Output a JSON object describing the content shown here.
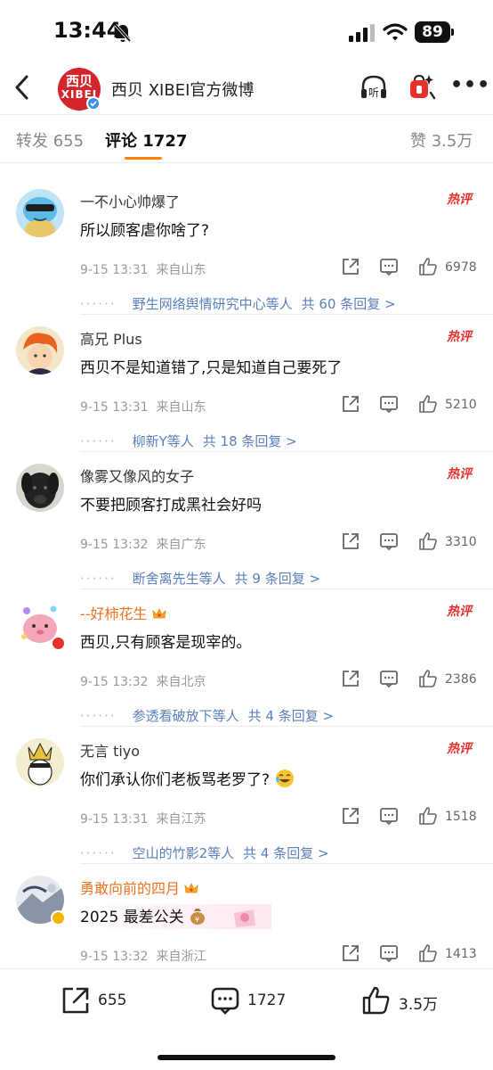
{
  "status_bar": {
    "time": "13:44",
    "battery": "89"
  },
  "header": {
    "avatar_line1": "西贝",
    "avatar_line2": "XIBEI",
    "title": "西贝 XIBEI官方微博",
    "listen_label": "听"
  },
  "tabs": {
    "reposts": "转发 655",
    "comments": "评论 1727",
    "likes": "赞 3.5万"
  },
  "hot_label": "热评",
  "comments": [
    {
      "name": "一不小心帅爆了",
      "text": "所以顾客虐你啥了?",
      "time": "9-15 13:31",
      "location": "来自山东",
      "likes": "6978",
      "reply_users": "野生网络舆情研究中心等人",
      "reply_count": "共 60 条回复 >"
    },
    {
      "name": "高兄 Plus",
      "text": "西贝不是知道错了,只是知道自己要死了",
      "time": "9-15 13:31",
      "location": "来自山东",
      "likes": "5210",
      "reply_users": "柳新Y等人",
      "reply_count": "共 18 条回复 >"
    },
    {
      "name": "像雾又像风的女子",
      "text": "不要把顾客打成黑社会好吗",
      "time": "9-15 13:32",
      "location": "来自广东",
      "likes": "3310",
      "reply_users": "断舍离先生等人",
      "reply_count": "共 9 条回复 >"
    },
    {
      "name": "--好柿花生",
      "text": "西贝,只有顾客是现宰的。",
      "time": "9-15 13:32",
      "location": "来自北京",
      "likes": "2386",
      "reply_users": "参透看破放下等人",
      "reply_count": "共 4 条回复 >"
    },
    {
      "name": "无言 tiyo",
      "text": "你们承认你们老板骂老罗了?",
      "time": "9-15 13:31",
      "location": "来自江苏",
      "likes": "1518",
      "reply_users": "空山的竹影2等人",
      "reply_count": "共 4 条回复 >"
    },
    {
      "name": "勇敢向前的四月",
      "text": "2025 最差公关",
      "time": "9-15 13:32",
      "location": "来自浙江",
      "likes": "1413"
    }
  ],
  "bottom_bar": {
    "reposts": "655",
    "comments": "1727",
    "likes": "3.5万"
  },
  "colors": {
    "accent": "#ff8200",
    "hot": "#e5322d",
    "link": "#5b7fbd",
    "vip_name": "#f0721f",
    "brand": "#d2262c"
  }
}
